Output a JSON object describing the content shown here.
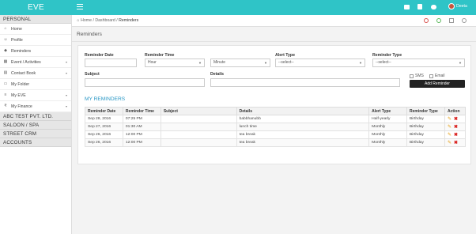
{
  "app": {
    "logo": "EVE",
    "user": "Deeta"
  },
  "sidebar": {
    "personal": "PERSONAL",
    "items": [
      {
        "label": "Home",
        "icon": "home-icon"
      },
      {
        "label": "Profile",
        "icon": "profile-icon"
      },
      {
        "label": "Reminders",
        "icon": "bell-icon"
      },
      {
        "label": "Event / Activities",
        "icon": "calendar-icon"
      },
      {
        "label": "Contact Book",
        "icon": "book-icon"
      },
      {
        "label": "My Folder",
        "icon": "folder-icon"
      },
      {
        "label": "My EVE",
        "icon": "list-icon"
      },
      {
        "label": "My Finance",
        "icon": "rupee-icon"
      }
    ],
    "sections": [
      "ABC TEST PVT. LTD.",
      "SALOON / SPA",
      "STREET CRM",
      "ACCOUNTS"
    ]
  },
  "breadcrumb": {
    "home": "Home",
    "dashboard": "Dashboard",
    "current": "Reminders",
    "sep": "/"
  },
  "page": {
    "title": "Reminders"
  },
  "form": {
    "date_label": "Reminder Date",
    "time_label": "Reminder Time",
    "hour": "Hour",
    "minute": "Minute",
    "alert_label": "Alert Type",
    "alert_value": "--select--",
    "rtype_label": "Reminder Type",
    "rtype_value": "--select--",
    "subject_label": "Subject",
    "details_label": "Details",
    "sms": "SMS",
    "email": "Email",
    "add_button": "Add Reminder"
  },
  "list": {
    "heading": "MY REMINDERS",
    "columns": [
      "Reminder Date",
      "Reminder Time",
      "Subject",
      "Details",
      "Alert Type",
      "Reminder Type",
      "Action"
    ],
    "rows": [
      {
        "date": "Sep 28, 2016",
        "time": "07:25 PM",
        "subject": "",
        "details": "babbhanubb",
        "alert": "Half-yearly",
        "type": "Birthday"
      },
      {
        "date": "Sep 27, 2016",
        "time": "01:30 AM",
        "subject": "",
        "details": "lunch time",
        "alert": "Monthly",
        "type": "Birthday"
      },
      {
        "date": "Sep 26, 2016",
        "time": "12:00 PM",
        "subject": "",
        "details": "tea break",
        "alert": "Monthly",
        "type": "Birthday"
      },
      {
        "date": "Sep 26, 2016",
        "time": "12:00 PM",
        "subject": "",
        "details": "tea break",
        "alert": "Monthly",
        "type": "Birthday"
      }
    ]
  },
  "colors": {
    "accent": "#2fc4c7",
    "link": "#2b98c6",
    "button": "#222222",
    "edit": "#e6a118",
    "delete": "#d9201e"
  }
}
